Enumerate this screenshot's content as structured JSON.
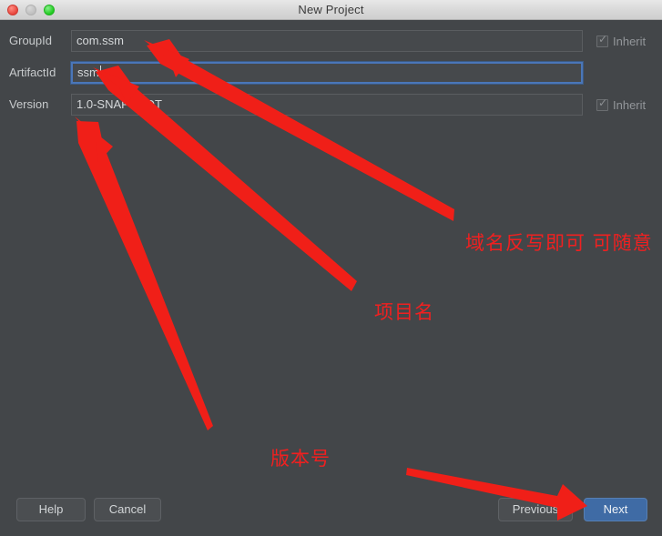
{
  "window": {
    "title": "New Project",
    "controls": [
      {
        "name": "close",
        "color": "#e8453c"
      },
      {
        "name": "minimize",
        "color": "#bfbfbf"
      },
      {
        "name": "maximize",
        "color": "#1fca1f"
      }
    ]
  },
  "form": {
    "rows": [
      {
        "label": "GroupId",
        "value": "com.ssm",
        "focused": false,
        "inherit": {
          "visible": true,
          "label": "Inherit",
          "checked": true,
          "enabled": false
        }
      },
      {
        "label": "ArtifactId",
        "value": "ssm",
        "focused": true,
        "inherit": {
          "visible": false,
          "label": "Inherit",
          "checked": false,
          "enabled": false
        }
      },
      {
        "label": "Version",
        "value": "1.0-SNAPSHOT",
        "focused": false,
        "inherit": {
          "visible": true,
          "label": "Inherit",
          "checked": true,
          "enabled": false
        }
      }
    ]
  },
  "buttons": {
    "help": "Help",
    "cancel": "Cancel",
    "previous": "Previous",
    "next": "Next"
  },
  "annotations": {
    "color": "#f02020",
    "items": [
      {
        "text": "域名反写即可 可随意",
        "target": "GroupId"
      },
      {
        "text": "项目名",
        "target": "ArtifactId"
      },
      {
        "text": "版本号",
        "target": "Version"
      }
    ]
  },
  "checkbox_glyph": "✓"
}
